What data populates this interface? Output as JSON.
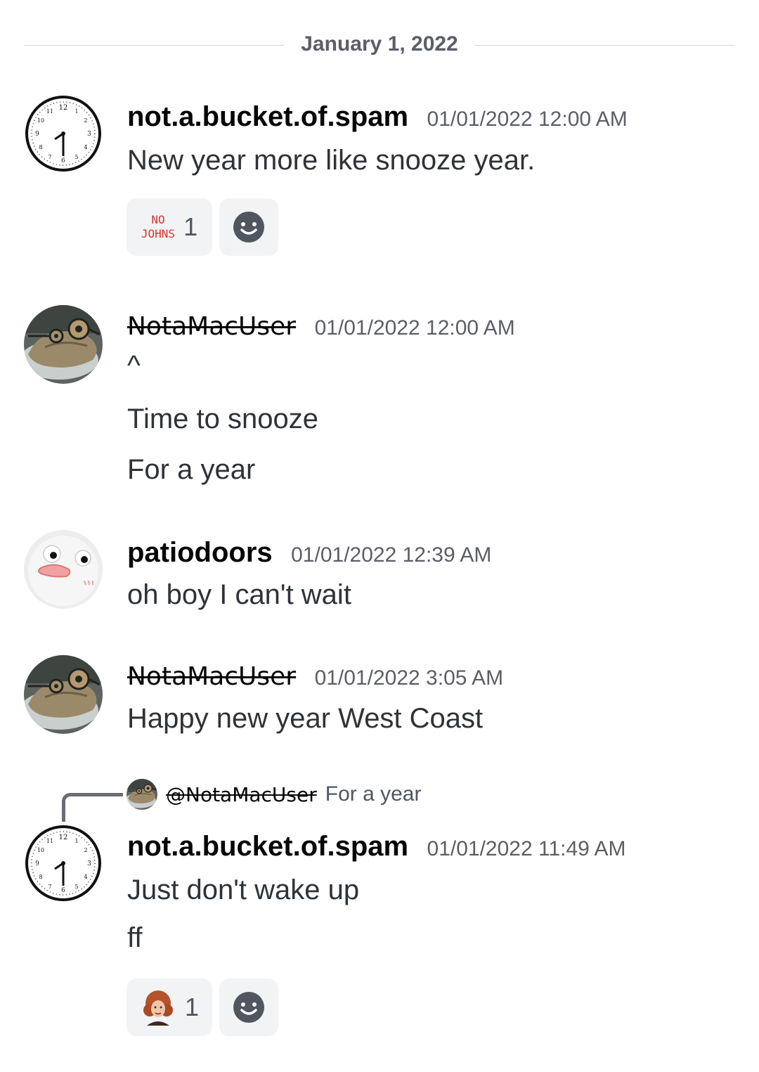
{
  "date_divider": "January 1, 2022",
  "messages": [
    {
      "author": "not.a.bucket.of.spam",
      "timestamp": "01/01/2022 12:00 AM",
      "lines": [
        "New year more like snooze year."
      ],
      "reactions": [
        {
          "emoji_text_top": "NO",
          "emoji_text_bottom": "JOHNS",
          "count": "1"
        }
      ]
    },
    {
      "author": "NotaMacUser",
      "timestamp": "01/01/2022 12:00 AM",
      "lines": [
        "^",
        "Time to snooze",
        "For a year"
      ]
    },
    {
      "author": "patiodoors",
      "timestamp": "01/01/2022 12:39 AM",
      "lines": [
        "oh boy I can't wait"
      ]
    },
    {
      "author": "NotaMacUser",
      "timestamp": "01/01/2022 3:05 AM",
      "lines": [
        "Happy new year West Coast"
      ]
    },
    {
      "reply_to": {
        "mention": "@NotaMacUser",
        "snippet": "For a year"
      },
      "author": "not.a.bucket.of.spam",
      "timestamp": "01/01/2022 11:49 AM",
      "lines": [
        "Just don't wake up",
        "ff"
      ],
      "reactions": [
        {
          "emoji": "woman-portrait-emoji",
          "count": "1"
        }
      ]
    }
  ],
  "icons": {
    "clock_avatar": "clock-icon",
    "lizard_avatar": "lizard-avatar",
    "blob_avatar": "blob-face-avatar",
    "add_reaction": "smiley-icon"
  },
  "colors": {
    "background": "#ffffff",
    "text": "#2e3338",
    "muted": "#5c5e66",
    "reaction_bg": "#f2f3f5",
    "no_johns_red": "#d9342b"
  }
}
